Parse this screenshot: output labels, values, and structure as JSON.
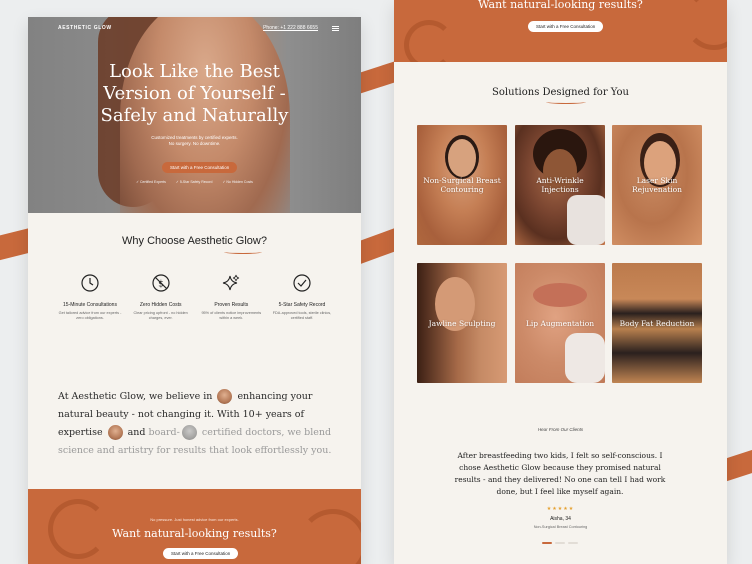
{
  "colors": {
    "accent": "#c8693c",
    "cream": "#f6f3ee",
    "dark": "#1e1e1e"
  },
  "nav": {
    "logo": "AESTHETIC GLOW",
    "phone": "Phone: +1 222 888 6655"
  },
  "hero": {
    "title_lines": [
      "Look Like the Best",
      "Version of Yourself -",
      "Safely and Naturally"
    ],
    "subtitle_lines": [
      "Customized treatments by certified experts.",
      "No surgery. No downtime."
    ],
    "cta": "Start with a Free Consultation",
    "checks": [
      "Certified Experts",
      "5-Star Safety Record",
      "No Hidden Costs"
    ]
  },
  "why": {
    "title": "Why Choose Aesthetic Glow?",
    "features": [
      {
        "icon": "clock-icon",
        "title": "15-Minute Consultations",
        "desc": "Get tailored advice from our experts - zero obligations."
      },
      {
        "icon": "no-dollar-icon",
        "title": "Zero Hidden Costs",
        "desc": "Clear pricing upfront - no hidden charges, ever."
      },
      {
        "icon": "sparkle-icon",
        "title": "Proven Results",
        "desc": "95% of clients notice improvements within a week."
      },
      {
        "icon": "check-circle-icon",
        "title": "5-Star Safety Record",
        "desc": "FDA-approved tools, sterile clinics, certified staff."
      }
    ]
  },
  "about": {
    "part1": "At Aesthetic Glow, we believe in",
    "part2": "enhancing your natural beauty - not changing it. With 10+ years of expertise",
    "part3": "and",
    "part4": "board-",
    "part5": "certified doctors, we blend science and artistry for results that look effortlessly you."
  },
  "cta_left": {
    "small": "No pressure. Just honest advice from our experts.",
    "title": "Want natural-looking results?",
    "button": "Start with a Free Consultation"
  },
  "cta_right": {
    "title": "Want natural-looking results?",
    "button": "Start with a Free Consultation"
  },
  "solutions": {
    "title": "Solutions Designed for You",
    "items": [
      "Non-Surgical Breast Contouring",
      "Anti-Wrinkle Injections",
      "Laser Skin Rejuvenation",
      "Jawline Sculpting",
      "Lip Augmentation",
      "Body Fat Reduction"
    ]
  },
  "testimonial": {
    "label": "Hear From Our Clients",
    "quote": "After breastfeeding two kids, I felt so self-conscious. I chose Aesthetic Glow because they promised natural results - and they delivered! No one can tell I had work done, but I feel like myself again.",
    "stars": "★★★★★",
    "author": "Aisha, 34",
    "procedure": "Non-Surgical Breast Contouring"
  }
}
